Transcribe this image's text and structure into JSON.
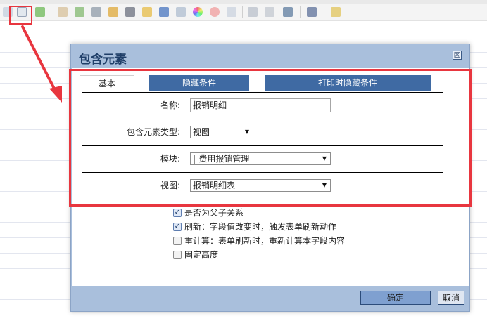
{
  "dialog": {
    "title": "包含元素",
    "close_glyph": "☒"
  },
  "tabs": [
    {
      "label": "基本"
    },
    {
      "label": "隐藏条件"
    },
    {
      "label": "打印时隐藏条件"
    }
  ],
  "form": {
    "name_label": "名称:",
    "name_value": "报销明细",
    "element_type_label": "包含元素类型:",
    "element_type_value": "视图",
    "module_label": "模块:",
    "module_value": "|-费用报销管理",
    "view_label": "视图:",
    "view_value": "报销明细表"
  },
  "options": [
    {
      "label": "是否为父子关系",
      "checked": true
    },
    {
      "label": "刷新：字段值改变时，触发表单刷新动作",
      "checked": true
    },
    {
      "label": "重计算：表单刷新时，重新计算本字段内容",
      "checked": false
    },
    {
      "label": "固定高度",
      "checked": false
    }
  ],
  "buttons": {
    "ok": "确定",
    "cancel": "取消"
  },
  "colors": {
    "annotation_red": "#e8363f",
    "dialog_frame": "#a9bfdc",
    "tab_active_blue": "#3f6aa3"
  },
  "toolbar_icons": [
    "include-element-icon",
    "table-icon",
    "pencil-icon",
    "image-icon",
    "video-icon",
    "map-icon",
    "qrcode-icon",
    "chart-icon",
    "word-icon",
    "attachment-icon",
    "color-wheel-icon",
    "record-icon",
    "frame-icon",
    "link-icon",
    "anchor-icon",
    "font-size-icon",
    "spellcheck-icon"
  ]
}
